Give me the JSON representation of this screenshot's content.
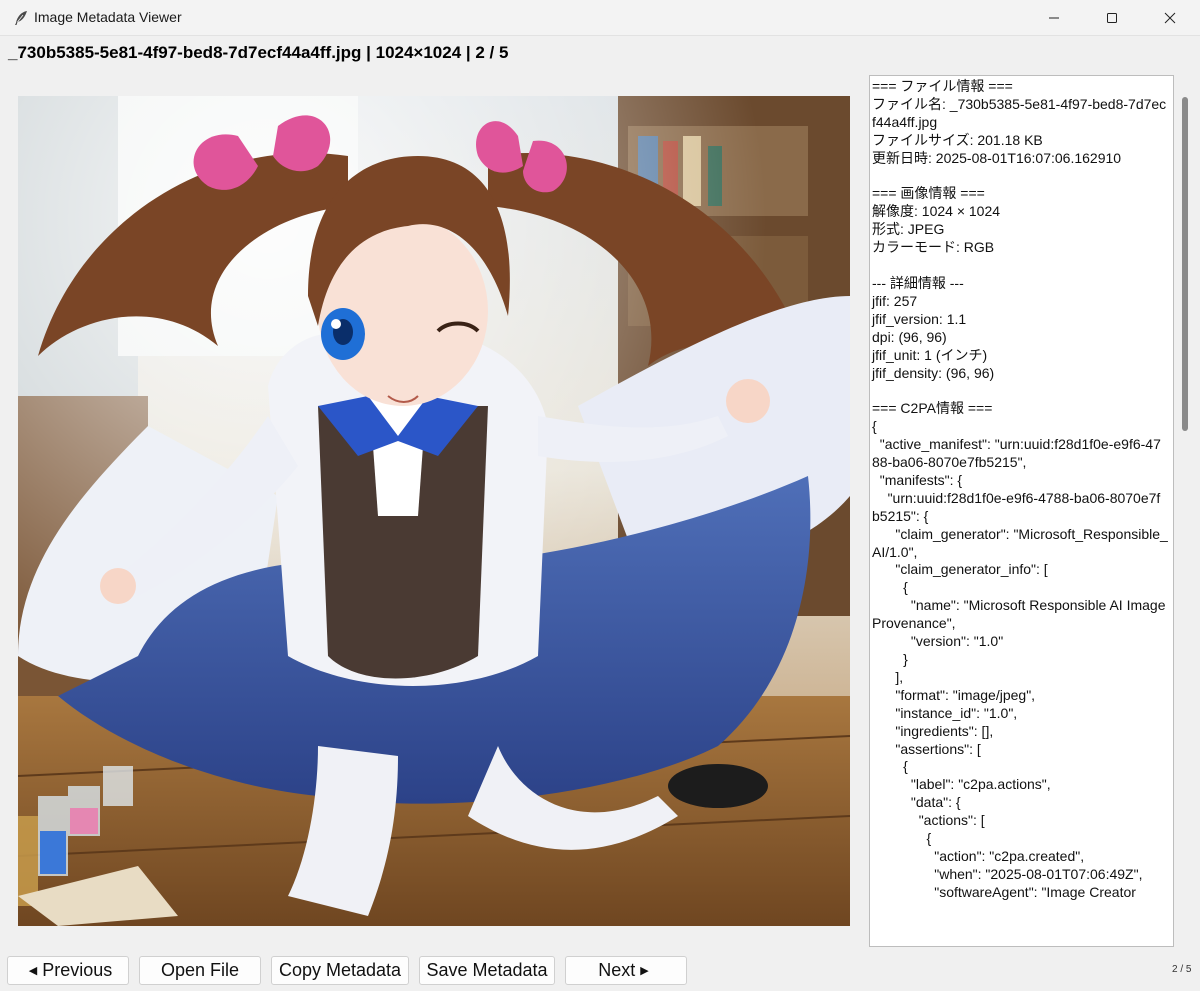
{
  "window": {
    "title": "Image Metadata Viewer",
    "icon": "feather-icon",
    "controls": [
      "minimize-icon",
      "maximize-icon",
      "close-icon"
    ]
  },
  "header": {
    "info": "_730b5385-5e81-4f97-bed8-7d7ecf44a4ff.jpg | 1024×1024 | 2 / 5"
  },
  "image": {
    "subject": "anime illustration of a girl with brown twin-tail hair and pink ribbons, white jacket, brown vest, blue bow and pleated blue skirt, kneeling on a wooden floor in a classroom"
  },
  "metadata_text": "=== ファイル情報 ===\nファイル名: _730b5385-5e81-4f97-bed8-7d7ecf44a4ff.jpg\nファイルサイズ: 201.18 KB\n更新日時: 2025-08-01T16:07:06.162910\n\n=== 画像情報 ===\n解像度: 1024 × 1024\n形式: JPEG\nカラーモード: RGB\n\n--- 詳細情報 ---\njfif: 257\njfif_version: 1.1\ndpi: (96, 96)\njfif_unit: 1 (インチ)\njfif_density: (96, 96)\n\n=== C2PA情報 ===\n{\n  \"active_manifest\": \"urn:uuid:f28d1f0e-e9f6-4788-ba06-8070e7fb5215\",\n  \"manifests\": {\n    \"urn:uuid:f28d1f0e-e9f6-4788-ba06-8070e7fb5215\": {\n      \"claim_generator\": \"Microsoft_Responsible_AI/1.0\",\n      \"claim_generator_info\": [\n        {\n          \"name\": \"Microsoft Responsible AI Image Provenance\",\n          \"version\": \"1.0\"\n        }\n      ],\n      \"format\": \"image/jpeg\",\n      \"instance_id\": \"1.0\",\n      \"ingredients\": [],\n      \"assertions\": [\n        {\n          \"label\": \"c2pa.actions\",\n          \"data\": {\n            \"actions\": [\n              {\n                \"action\": \"c2pa.created\",\n                \"when\": \"2025-08-01T07:06:49Z\",\n                \"softwareAgent\": \"Image Creator",
  "buttons": {
    "previous": "Previous",
    "open_file": "Open File",
    "copy_metadata": "Copy Metadata",
    "save_metadata": "Save Metadata",
    "next": "Next"
  },
  "page_counter": "2 / 5"
}
